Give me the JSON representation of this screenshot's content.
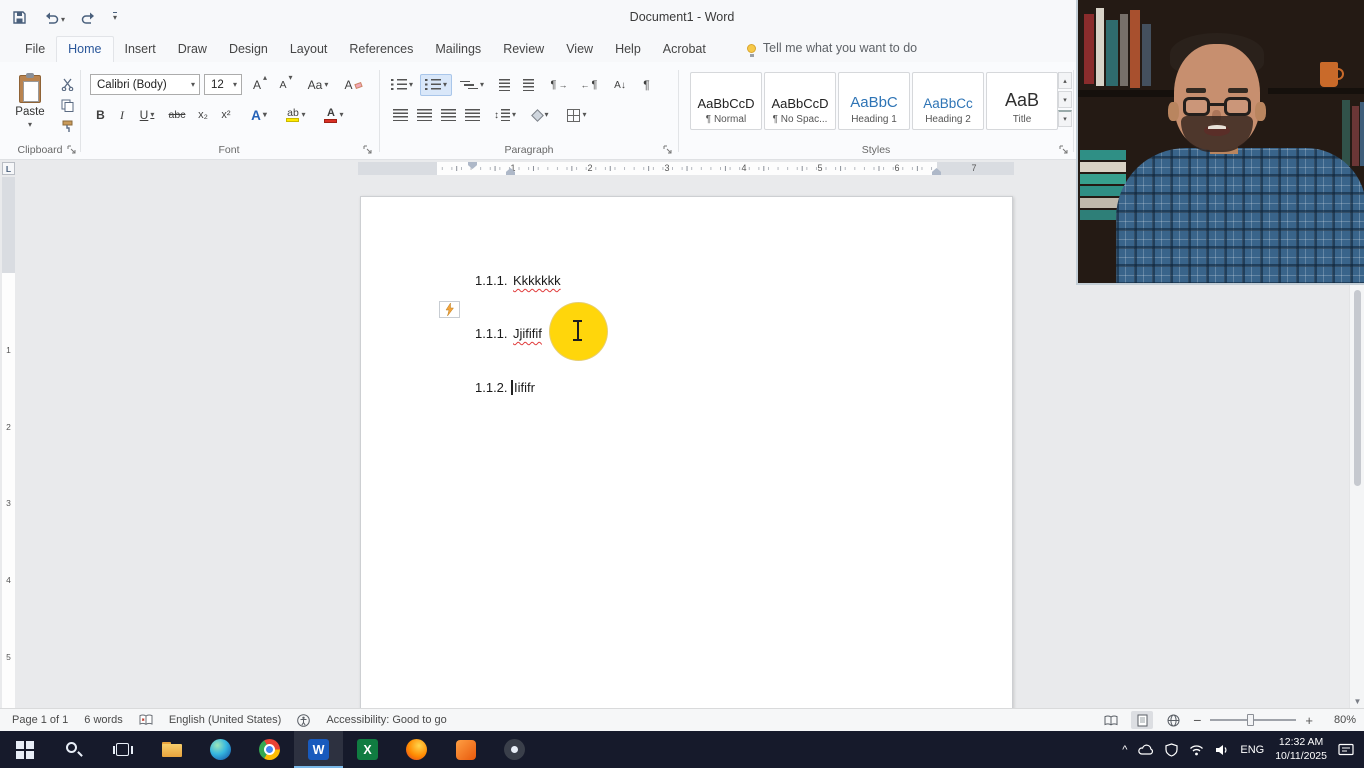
{
  "titlebar": {
    "title": "Document1 - Word"
  },
  "glyphs": {
    "caret_down": "▾",
    "caret_up": "▴",
    "bold": "B",
    "italic": "I",
    "underline": "U",
    "strike": "abc",
    "subscript": "x₂",
    "superscript": "x²",
    "text_effects": "A",
    "highlight": "ab",
    "font_color": "A",
    "change_case": "Aa",
    "grow_font": "A",
    "shrink_font": "A",
    "clear_formatting": "A",
    "pilcrow": "¶",
    "sort": "A↓",
    "arrow_left": "←",
    "arrow_right": "→",
    "tab_selector": "L",
    "word_letter": "W",
    "excel_letter": "X",
    "zoom_out": "−",
    "zoom_in": "+",
    "tray_caret": "^",
    "scroll_down": "▼"
  },
  "ribbon": {
    "tabs": [
      {
        "label": "File"
      },
      {
        "label": "Home"
      },
      {
        "label": "Insert"
      },
      {
        "label": "Draw"
      },
      {
        "label": "Design"
      },
      {
        "label": "Layout"
      },
      {
        "label": "References"
      },
      {
        "label": "Mailings"
      },
      {
        "label": "Review"
      },
      {
        "label": "View"
      },
      {
        "label": "Help"
      },
      {
        "label": "Acrobat"
      }
    ],
    "tell_me": "Tell me what you want to do",
    "groups": {
      "clipboard": {
        "label": "Clipboard",
        "paste_label": "Paste"
      },
      "font": {
        "label": "Font",
        "font_name": "Calibri (Body)",
        "font_size": "12"
      },
      "paragraph": {
        "label": "Paragraph"
      },
      "styles": {
        "label": "Styles",
        "items": [
          {
            "preview": "AaBbCcD",
            "name": "¶ Normal"
          },
          {
            "preview": "AaBbCcD",
            "name": "¶ No Spac..."
          },
          {
            "preview": "AaBbC",
            "name": "Heading 1"
          },
          {
            "preview": "AaBbCc",
            "name": "Heading 2"
          },
          {
            "preview": "AaB",
            "name": "Title"
          }
        ]
      }
    }
  },
  "ruler": {
    "numbers": [
      "1",
      "2",
      "3",
      "4",
      "5",
      "6",
      "7"
    ],
    "v_numbers": [
      "1",
      "2",
      "3",
      "4",
      "5"
    ]
  },
  "document": {
    "lines": [
      {
        "number": "1.1.1.",
        "text": "Kkkkkkk"
      },
      {
        "number": "1.1.1.",
        "text": "Jjififif"
      },
      {
        "number": "1.1.2.",
        "text": "Iififr"
      }
    ]
  },
  "statusbar": {
    "page": "Page 1 of 1",
    "words": "6 words",
    "language": "English (United States)",
    "accessibility": "Accessibility: Good to go",
    "zoom_level": "80%"
  },
  "taskbar": {
    "language": "ENG",
    "time": "12:32 AM",
    "date": "10/11/2025"
  }
}
